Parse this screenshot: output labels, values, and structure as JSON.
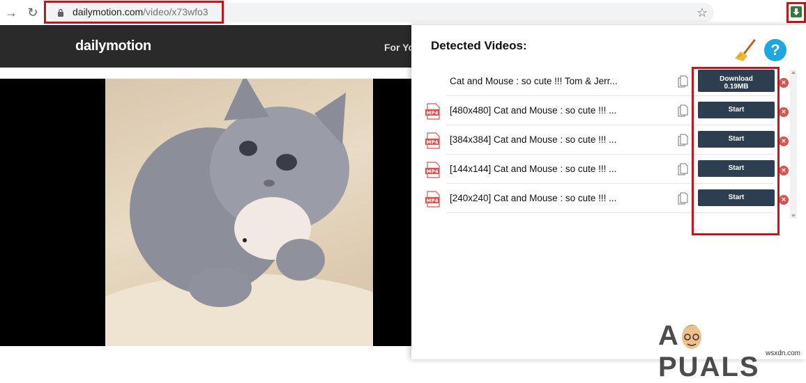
{
  "browser": {
    "url_domain": "dailymotion.com",
    "url_path": "/video/x73wfo3",
    "back_icon": "arrow-right",
    "reload_icon": "reload",
    "bookmark_icon": "star-outline"
  },
  "site": {
    "logo": "dailymotion",
    "nav_item": "For Yo"
  },
  "popup": {
    "title": "Detected Videos:",
    "rows": [
      {
        "title": "Cat and Mouse : so cute !!! Tom & Jerr...",
        "has_mp4_icon": false,
        "button_line1": "Download",
        "button_line2": "0.19MB"
      },
      {
        "title": "[480x480] Cat and Mouse : so cute !!! ...",
        "has_mp4_icon": true,
        "button_label": "Start"
      },
      {
        "title": "[384x384] Cat and Mouse : so cute !!! ...",
        "has_mp4_icon": true,
        "button_label": "Start"
      },
      {
        "title": "[144x144] Cat and Mouse : so cute !!! ...",
        "has_mp4_icon": true,
        "button_label": "Start"
      },
      {
        "title": "[240x240] Cat and Mouse : so cute !!! ...",
        "has_mp4_icon": true,
        "button_label": "Start"
      }
    ],
    "mp4_label": "MP4",
    "help_label": "?",
    "remove_label": "×"
  },
  "watermark": {
    "brand": "APPUALS",
    "brand_a": "A",
    "brand_rest": "PUALS",
    "site": "wsxdn.com"
  },
  "colors": {
    "highlight": "#c4151c",
    "button_bg": "#2c3e50",
    "remove": "#d9534f",
    "help": "#1ea6e0",
    "header_bg": "#2a2a2a"
  }
}
